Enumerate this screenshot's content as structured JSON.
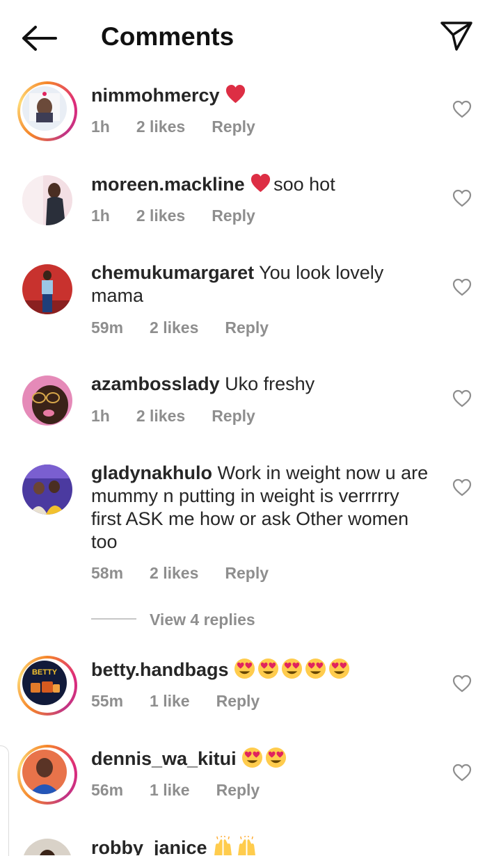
{
  "header": {
    "title": "Comments",
    "back_icon": "arrow-left-icon",
    "send_icon": "paper-plane-icon"
  },
  "comments": [
    {
      "username": "nimmohmercy",
      "text": "",
      "emoji": [
        "red-heart"
      ],
      "time": "1h",
      "likes": "2 likes",
      "reply": "Reply",
      "story_ring": true
    },
    {
      "username": "moreen.mackline",
      "text": "soo hot",
      "emoji": [
        "red-heart"
      ],
      "time": "1h",
      "likes": "2 likes",
      "reply": "Reply",
      "story_ring": false
    },
    {
      "username": "chemukumargaret",
      "text": "You look lovely mama",
      "emoji": [],
      "time": "59m",
      "likes": "2 likes",
      "reply": "Reply",
      "story_ring": false
    },
    {
      "username": "azambosslady",
      "text": "Uko freshy",
      "emoji": [],
      "time": "1h",
      "likes": "2 likes",
      "reply": "Reply",
      "story_ring": false
    },
    {
      "username": "gladynakhulo",
      "text": "Work in weight now u are mummy n putting in weight is verrrrry first ASK me how or ask Other women too",
      "emoji": [],
      "time": "58m",
      "likes": "2 likes",
      "reply": "Reply",
      "story_ring": false
    },
    {
      "username": "betty.handbags",
      "text": "",
      "emoji": [
        "heart-eyes",
        "heart-eyes",
        "heart-eyes",
        "heart-eyes",
        "heart-eyes"
      ],
      "time": "55m",
      "likes": "1 like",
      "reply": "Reply",
      "story_ring": true
    },
    {
      "username": "dennis_wa_kitui",
      "text": "",
      "emoji": [
        "heart-eyes",
        "heart-eyes"
      ],
      "time": "56m",
      "likes": "1 like",
      "reply": "Reply",
      "story_ring": true
    },
    {
      "username": "robby_janice",
      "text": "",
      "emoji": [
        "raised-hands",
        "raised-hands"
      ],
      "time": "",
      "likes": "",
      "reply": "",
      "story_ring": false
    }
  ],
  "view_replies": "View 4 replies",
  "avatar_badge_text": "BETTY"
}
